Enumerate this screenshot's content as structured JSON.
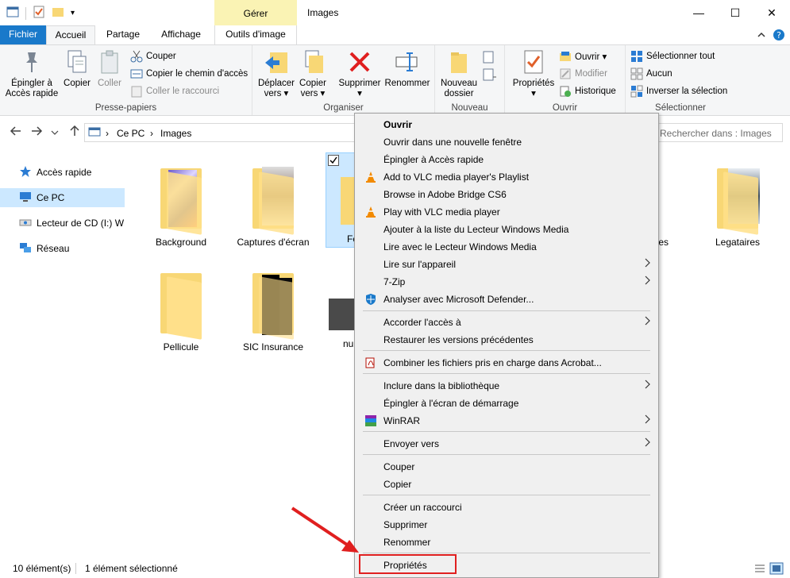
{
  "window": {
    "title": "Images",
    "context_tab": "Gérer",
    "controls": {
      "minimize": "—",
      "maximize": "☐",
      "close": "✕"
    }
  },
  "ribbon_tabs": {
    "file": "Fichier",
    "home": "Accueil",
    "share": "Partage",
    "view": "Affichage",
    "picture_tools": "Outils d'image"
  },
  "ribbon": {
    "clipboard": {
      "label": "Presse-papiers",
      "pin_line1": "Épingler à",
      "pin_line2": "Accès rapide",
      "copy": "Copier",
      "paste": "Coller",
      "cut": "Couper",
      "copy_path": "Copier le chemin d'accès",
      "paste_shortcut": "Coller le raccourci"
    },
    "organize": {
      "label": "Organiser",
      "move_line1": "Déplacer",
      "move_line2": "vers ▾",
      "copy_to_line1": "Copier",
      "copy_to_line2": "vers ▾",
      "delete_line1": "Supprimer",
      "delete_line2": "▾",
      "rename": "Renommer"
    },
    "new": {
      "label": "Nouveau",
      "new_folder_line1": "Nouveau",
      "new_folder_line2": "dossier"
    },
    "open": {
      "label": "Ouvrir",
      "properties_line1": "Propriétés",
      "properties_line2": "▾",
      "open": "Ouvrir ▾",
      "edit": "Modifier",
      "history": "Historique"
    },
    "select": {
      "label": "Sélectionner",
      "select_all": "Sélectionner tout",
      "select_none": "Aucun",
      "invert": "Inverser la sélection"
    }
  },
  "address": {
    "crumbs": [
      "Ce PC",
      "Images"
    ],
    "separator": "›",
    "search_placeholder": "Rechercher dans : Images"
  },
  "nav_pane": [
    {
      "label": "Accès rapide",
      "icon": "star-icon"
    },
    {
      "label": "Ce PC",
      "icon": "computer-icon",
      "selected": true
    },
    {
      "label": "Lecteur de CD (I:) WD",
      "icon": "cd-drive-icon"
    },
    {
      "label": "Réseau",
      "icon": "network-icon"
    }
  ],
  "items": [
    {
      "label": "Background"
    },
    {
      "label": "Captures d'écran"
    },
    {
      "label": "Fe"
    },
    {
      "label": "tes"
    },
    {
      "label": "Legataires"
    },
    {
      "label": "Pellicule"
    },
    {
      "label": "SIC Insurance"
    },
    {
      "label": "nu"
    }
  ],
  "context_menu": [
    {
      "label": "Ouvrir",
      "bold": true
    },
    {
      "label": "Ouvrir dans une nouvelle fenêtre"
    },
    {
      "label": "Épingler à Accès rapide"
    },
    {
      "label": "Add to VLC media player's Playlist",
      "icon": "vlc-icon"
    },
    {
      "label": "Browse in Adobe Bridge CS6"
    },
    {
      "label": "Play with VLC media player",
      "icon": "vlc-icon"
    },
    {
      "label": "Ajouter à la liste du Lecteur Windows Media"
    },
    {
      "label": "Lire avec le Lecteur Windows Media"
    },
    {
      "label": "Lire sur l'appareil",
      "submenu": true
    },
    {
      "label": "7-Zip",
      "submenu": true
    },
    {
      "label": "Analyser avec Microsoft Defender...",
      "icon": "defender-shield-icon"
    },
    {
      "label": "Accorder l'accès à",
      "submenu": true
    },
    {
      "label": "Restaurer les versions précédentes"
    },
    {
      "label": "Combiner les fichiers pris en charge dans Acrobat...",
      "icon": "acrobat-icon"
    },
    {
      "label": "Inclure dans la bibliothèque",
      "submenu": true
    },
    {
      "label": "Épingler à l'écran de démarrage"
    },
    {
      "label": "WinRAR",
      "submenu": true,
      "icon": "winrar-icon"
    },
    {
      "label": "Envoyer vers",
      "submenu": true
    },
    {
      "label": "Couper"
    },
    {
      "label": "Copier"
    },
    {
      "label": "Créer un raccourci"
    },
    {
      "label": "Supprimer"
    },
    {
      "label": "Renommer"
    },
    {
      "label": "Propriétés"
    }
  ],
  "status": {
    "count": "10 élément(s)",
    "selected": "1 élément sélectionné"
  },
  "colors": {
    "accent": "#1979ca",
    "selection": "#cce8ff",
    "context_tab": "#faf3b4",
    "highlight": "#e02020"
  }
}
